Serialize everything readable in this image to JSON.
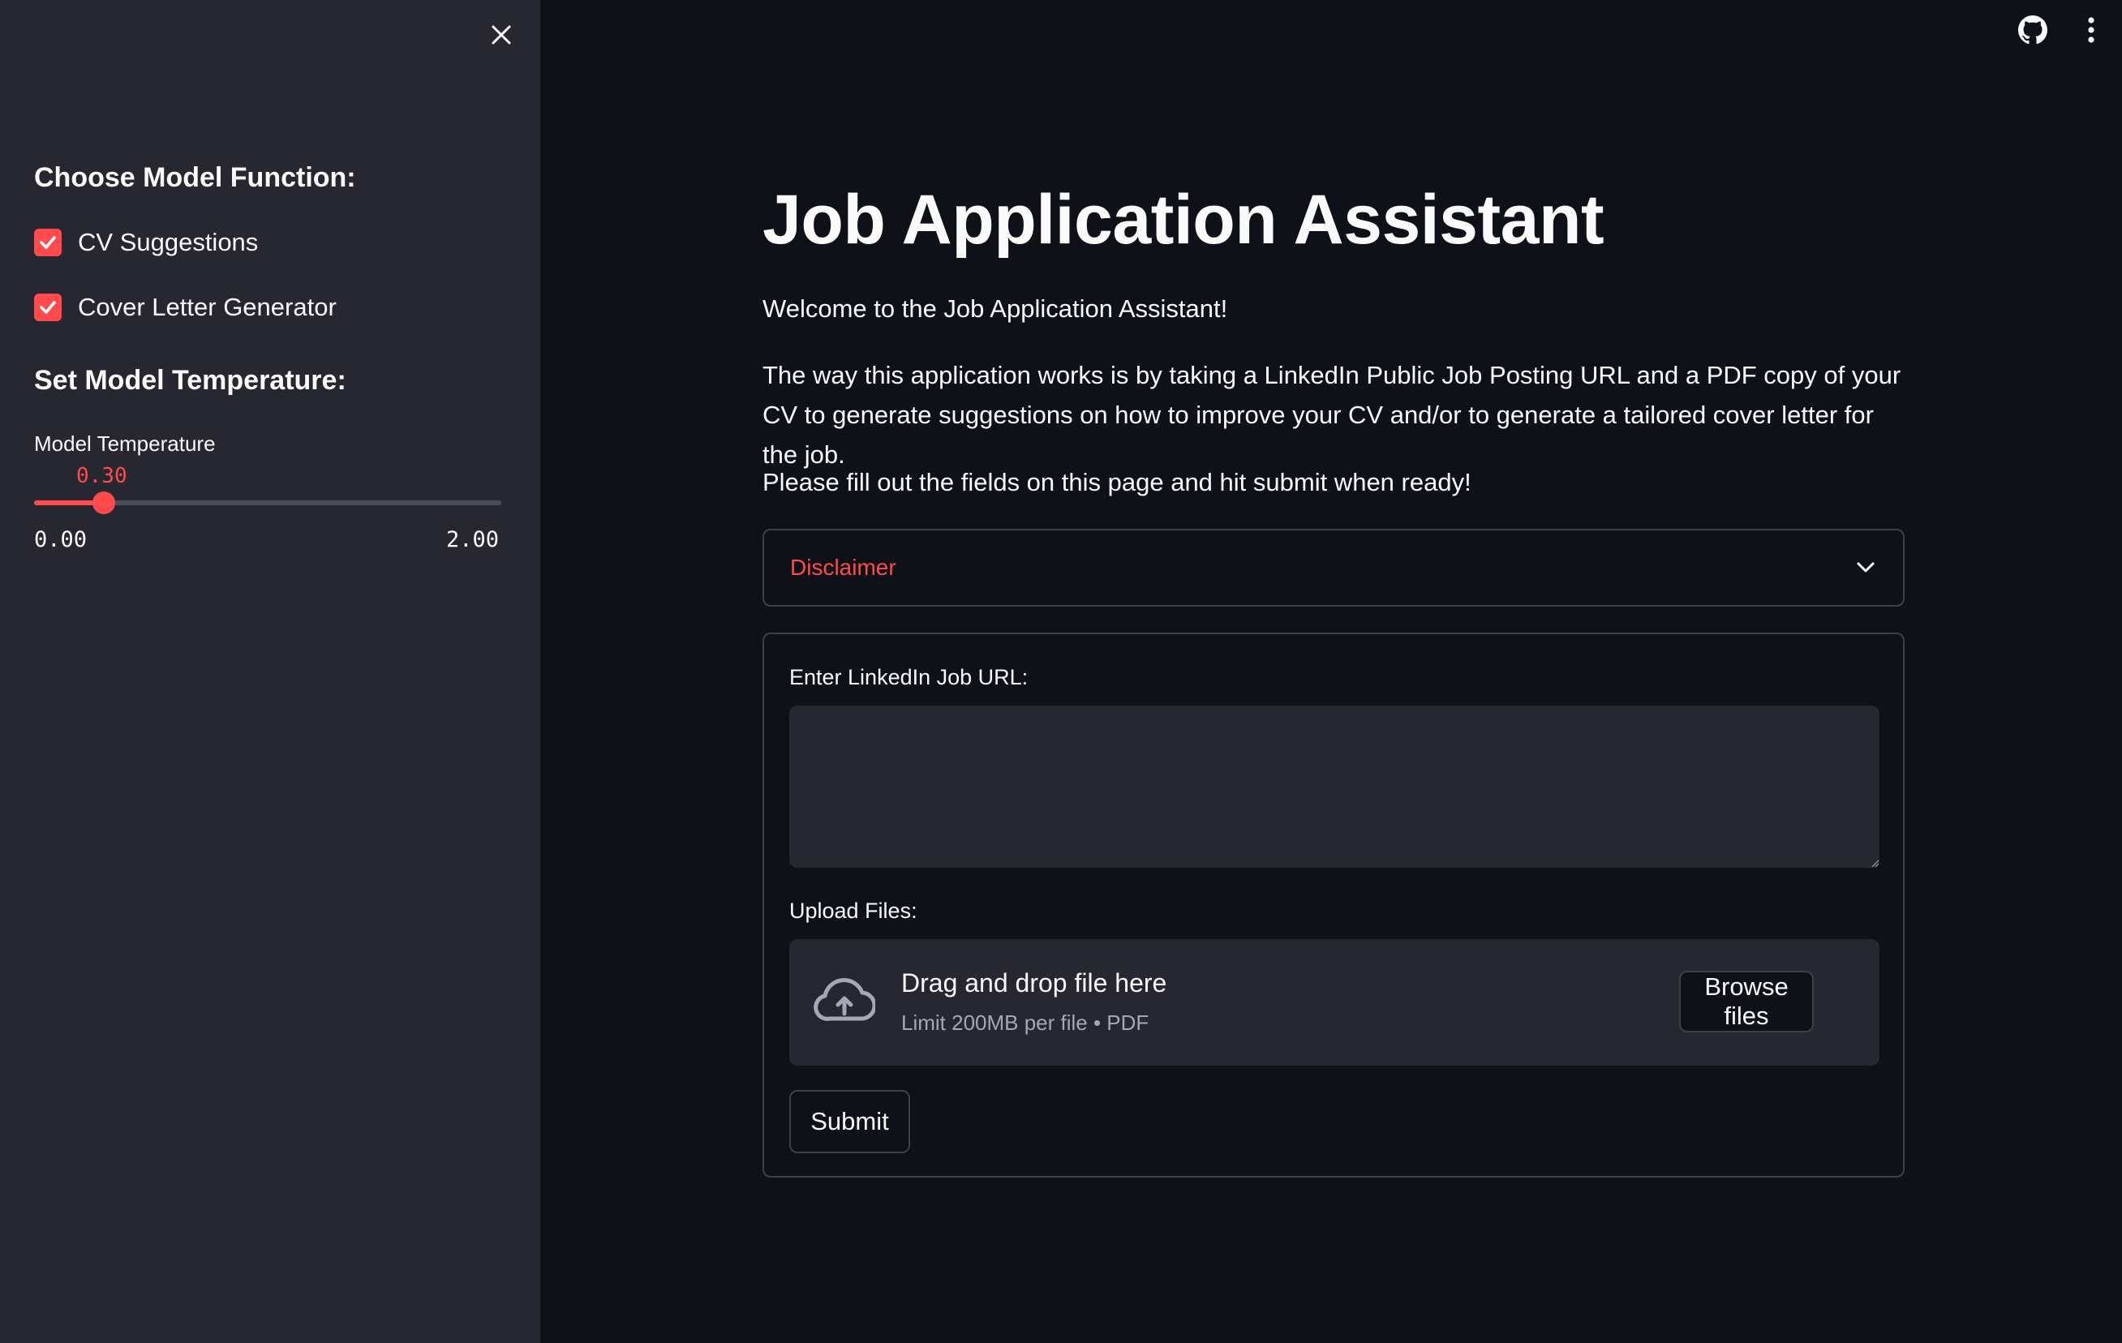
{
  "sidebar": {
    "function_heading": "Choose Model Function:",
    "options": [
      {
        "label": "CV Suggestions",
        "checked": true
      },
      {
        "label": "Cover Letter Generator",
        "checked": true
      }
    ],
    "temperature_heading": "Set Model Temperature:",
    "slider": {
      "label": "Model Temperature",
      "value_text": "0.30",
      "value": 0.3,
      "min_text": "0.00",
      "max_text": "2.00",
      "min": 0,
      "max": 2
    }
  },
  "toolbar": {
    "icons": [
      "github-icon",
      "more-vertical-icon",
      "close-icon"
    ]
  },
  "main": {
    "title": "Job Application Assistant",
    "welcome": "Welcome to the Job Application Assistant!",
    "description": "The way this application works is by taking a LinkedIn Public Job Posting URL and a PDF copy of your CV to generate suggestions on how to improve your CV and/or to generate a tailored cover letter for the job.",
    "instruction": "Please fill out the fields on this page and hit submit when ready!",
    "expander_label": "Disclaimer",
    "form": {
      "url_label": "Enter LinkedIn Job URL:",
      "url_value": "",
      "upload_label": "Upload Files:",
      "dropzone_title": "Drag and drop file here",
      "dropzone_limit": "Limit 200MB per file • PDF",
      "browse_label": "Browse files",
      "submit_label": "Submit"
    }
  },
  "colors": {
    "accent": "#ff4b4b",
    "background": "#0e1117",
    "sidebar": "#262730",
    "text": "#fafafa",
    "muted": "#a3a8b8",
    "border": "#3d3f4a"
  }
}
